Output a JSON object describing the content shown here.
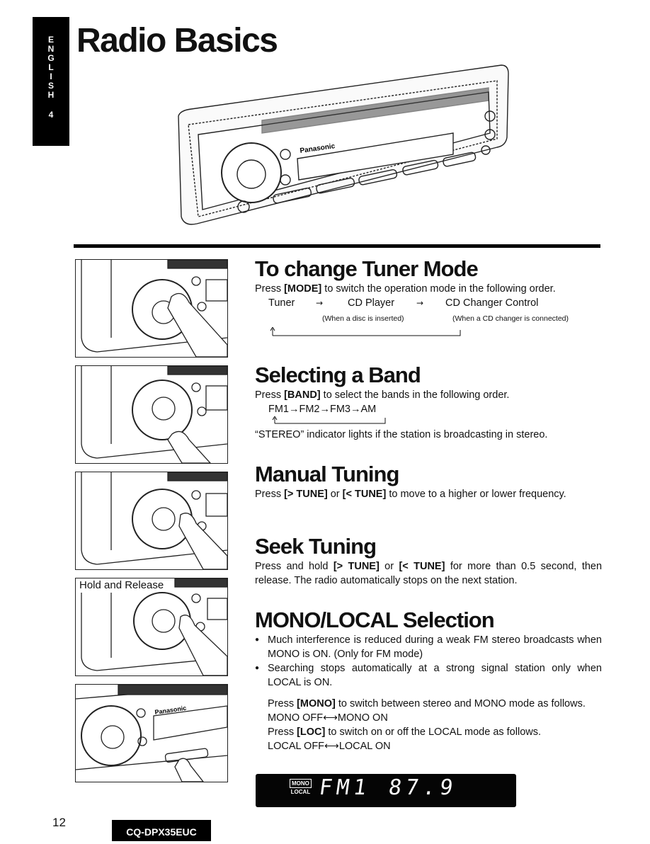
{
  "language_tab": {
    "letters": [
      "E",
      "N",
      "G",
      "L",
      "I",
      "S",
      "H"
    ],
    "number": "4"
  },
  "page_title": "Radio Basics",
  "photos": [
    {
      "caption": ""
    },
    {
      "caption": ""
    },
    {
      "caption": ""
    },
    {
      "caption": "Hold and Release"
    },
    {
      "caption": ""
    }
  ],
  "hero_labels": {
    "brand": "Panasonic"
  },
  "sections": {
    "tuner_mode": {
      "title": "To change Tuner Mode",
      "intro_pre": "Press ",
      "intro_key": "[MODE]",
      "intro_post": " to switch the operation mode in the following order.",
      "order": [
        "Tuner",
        "CD Player",
        "CD Changer Control"
      ],
      "arrow": "→",
      "notes": [
        "(When a disc is inserted)",
        "(When a CD changer is connected)"
      ]
    },
    "band": {
      "title": "Selecting a Band",
      "intro_pre": "Press ",
      "intro_key": "[BAND]",
      "intro_post": " to select the bands in the following order.",
      "order": "FM1→FM2→FM3→AM",
      "note": "“STEREO” indicator lights if the station is broadcasting in stereo."
    },
    "manual": {
      "title": "Manual Tuning",
      "pre": "Press ",
      "key1": "[> TUNE]",
      "mid": " or ",
      "key2": "[< TUNE]",
      "post": " to move to a higher or lower frequency."
    },
    "seek": {
      "title": "Seek Tuning",
      "pre": "Press and hold ",
      "key1": "[> TUNE]",
      "mid": " or ",
      "key2": "[< TUNE]",
      "post": " for more than 0.5 second, then release. The radio automatically stops on the next station."
    },
    "mono_local": {
      "title": "MONO/LOCAL Selection",
      "bullets": [
        "Much interference is reduced during a weak FM stereo broadcasts when MONO is ON. (Only for FM mode)",
        "Searching stops automatically at a strong signal station only when LOCAL is ON."
      ],
      "mono_pre": "Press ",
      "mono_key": "[MONO]",
      "mono_post": " to switch between stereo and MONO mode as follows.",
      "mono_toggle": "MONO OFF⟷MONO ON",
      "loc_pre": "Press ",
      "loc_key": "[LOC]",
      "loc_post": " to switch on or off the LOCAL mode as follows.",
      "loc_toggle": "LOCAL OFF⟷LOCAL ON"
    }
  },
  "display": {
    "mono_label": "MONO",
    "local_label": "LOCAL",
    "band": "FM1",
    "frequency": "87.9"
  },
  "footer": {
    "page_number": "12",
    "model": "CQ-DPX35EUC"
  }
}
